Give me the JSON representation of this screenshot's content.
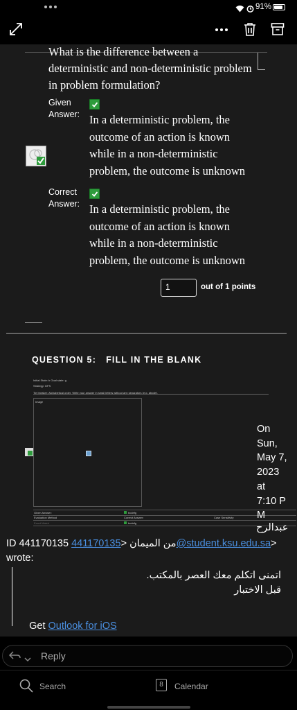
{
  "status": {
    "battery": "91%"
  },
  "question": {
    "text_lines": [
      "What is the difference between a",
      "deterministic and non-deterministic problem",
      "in problem formulation?"
    ],
    "given_label_1": "Given",
    "given_label_2": "Answer:",
    "given_answer_lines": [
      "In a deterministic problem, the",
      "outcome of an action is known",
      "while in a non-deterministic",
      "problem, the outcome is unknown"
    ],
    "correct_label_1": "Correct",
    "correct_label_2": "Answer:",
    "correct_answer_lines": [
      "In a deterministic problem, the",
      "outcome of an action is known",
      "while in a non-deterministic",
      "problem, the outcome is unknown"
    ],
    "points_value": "1",
    "points_suffix": "out of 1 points"
  },
  "question5": {
    "heading": "QUESTION 5:   FILL IN THE BLANK",
    "tiny_line1": "Initial State: b  Goal state: g",
    "tiny_line2": "Strategy: DFS",
    "tiny_line3": "Tie breaker: Alphabetical order. Write your answer in small letters without any separators (e.g. abcde).",
    "image_label": "Image",
    "given_answer_label": "Given Answer:",
    "given_answer_value": "bcdefg",
    "evaluation_method_label": "Evaluation Method",
    "correct_answer_label": "Correct Answer:",
    "case_sensitivity_label": "Case Sensitivity",
    "exact_match_label": "Exact Match",
    "correct_answer_value": "bcdefg"
  },
  "quote_header": {
    "date_words": [
      "On",
      "Sun,",
      "May 7,",
      "2023",
      "at",
      "7:10 P",
      "M"
    ],
    "arabic_name": "عبدالرح",
    "sender_line": "ID 441170135 من الميمان <",
    "sender_email": "441170135@student.ksu.edu.sa",
    "sender_close": ">",
    "wrote": "wrote:"
  },
  "quoted_message": {
    "line1": "اتمنى اتكلم معك العصر بالمكتب.",
    "line2": "قبل الاختبار"
  },
  "signature": {
    "prefix": "Get ",
    "link": "Outlook for iOS"
  },
  "reply": {
    "label": "Reply"
  },
  "bottom_nav": {
    "search": "Search",
    "calendar_day": "8",
    "calendar": "Calendar"
  }
}
